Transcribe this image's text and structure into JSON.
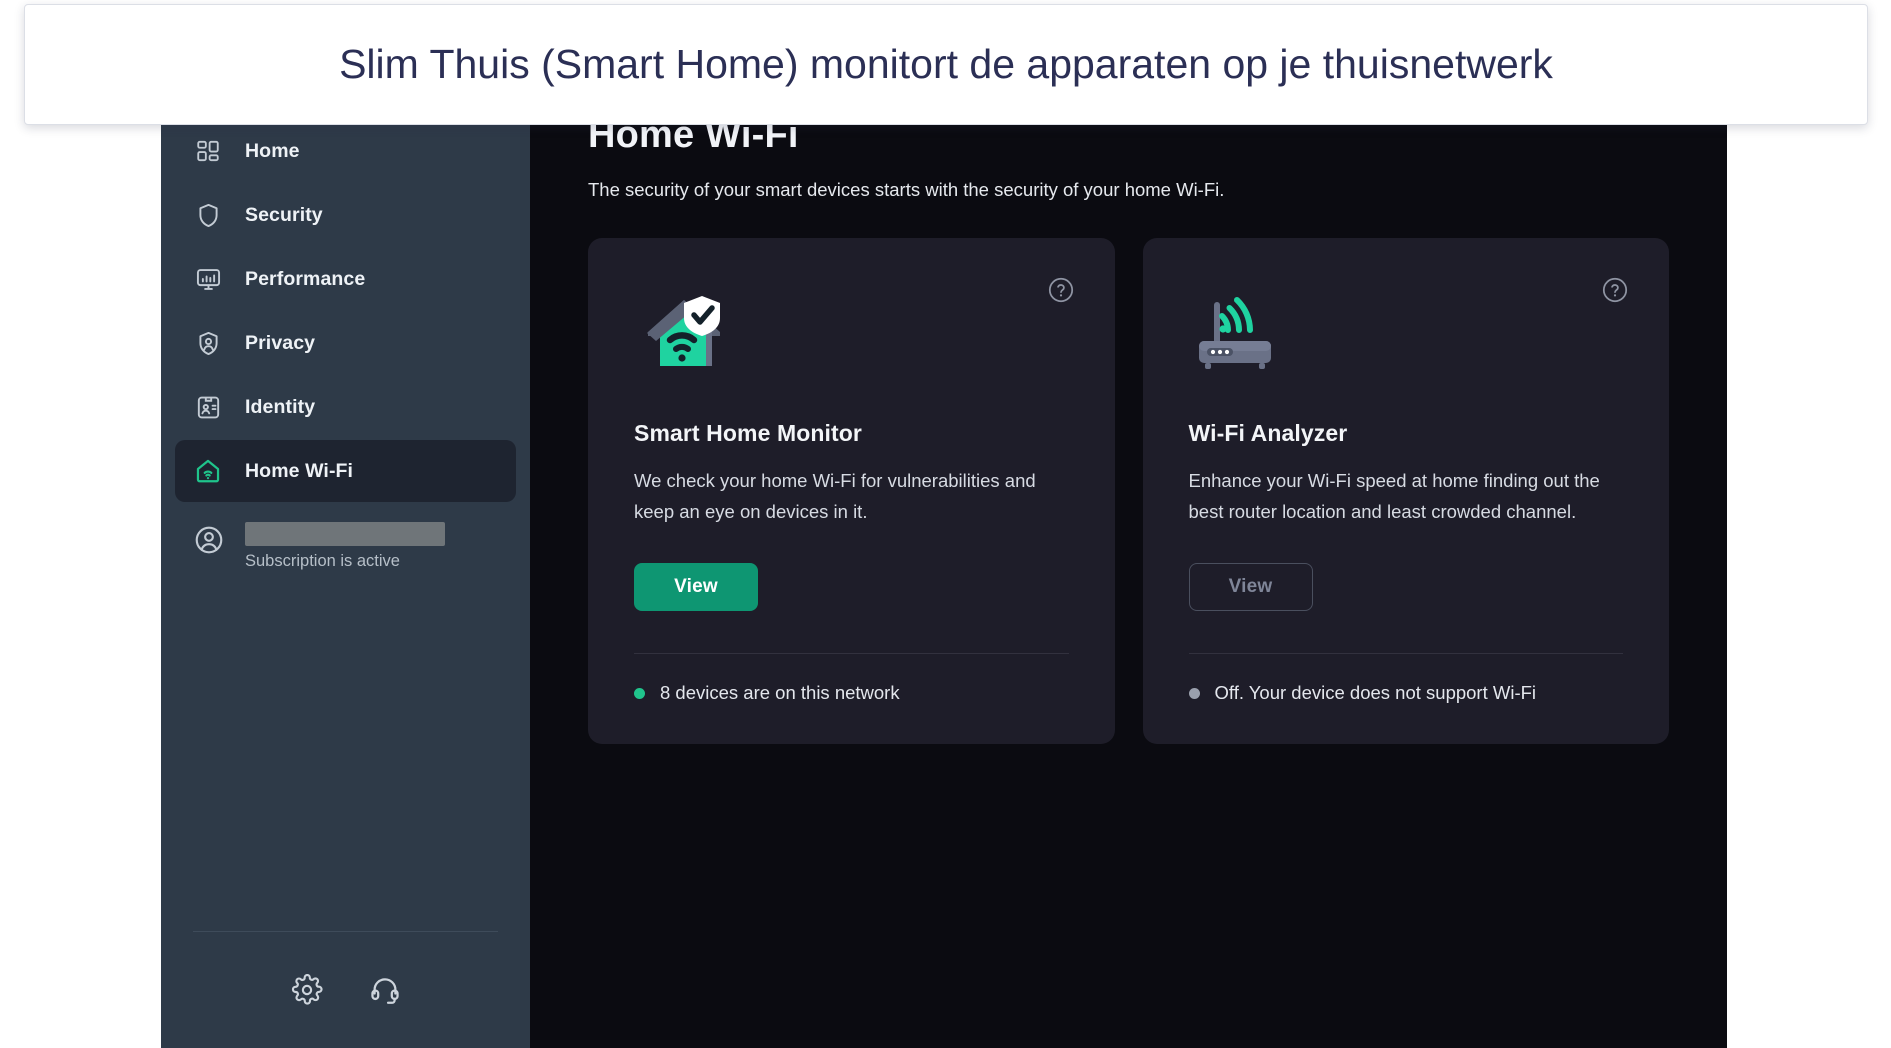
{
  "caption": {
    "text": "Slim Thuis (Smart Home) monitort de apparaten op je thuisnetwerk"
  },
  "sidebar": {
    "items": [
      {
        "label": "Home",
        "icon": "dashboard-grid-icon",
        "active": false
      },
      {
        "label": "Security",
        "icon": "shield-icon",
        "active": false
      },
      {
        "label": "Performance",
        "icon": "monitor-icon",
        "active": false
      },
      {
        "label": "Privacy",
        "icon": "privacy-shield-icon",
        "active": false
      },
      {
        "label": "Identity",
        "icon": "id-card-icon",
        "active": false
      },
      {
        "label": "Home Wi-Fi",
        "icon": "house-wifi-icon",
        "active": true
      }
    ],
    "account": {
      "name_redacted": "",
      "status": "Subscription is active",
      "avatar_icon": "user-circle-icon"
    },
    "footer": {
      "settings_icon": "gear-icon",
      "support_icon": "headset-icon"
    }
  },
  "main": {
    "title": "Home Wi-Fi",
    "subtitle": "The security of your smart devices starts with the security of your home Wi-Fi.",
    "cards": [
      {
        "id": "smart-home-monitor",
        "art_icon": "house-shield-wifi-icon",
        "help_icon": "question-circle-icon",
        "title": "Smart Home Monitor",
        "description": "We check your home Wi-Fi for vulnerabilities and keep an eye on devices in it.",
        "button_label": "View",
        "button_state": "primary",
        "status_text": "8 devices are on this network",
        "status_color": "#20c48c"
      },
      {
        "id": "wifi-analyzer",
        "art_icon": "router-wifi-icon",
        "help_icon": "question-circle-icon",
        "title": "Wi-Fi Analyzer",
        "description": "Enhance your Wi-Fi speed at home finding out the best router location and least crowded channel.",
        "button_label": "View",
        "button_state": "disabled",
        "status_text": "Off. Your device does not support Wi-Fi",
        "status_color": "#9aa0ad"
      }
    ]
  },
  "colors": {
    "accent_green": "#0e9672",
    "icon_green": "#1fc48b",
    "sidebar_bg": "#2e3a48",
    "card_bg": "#1e1d29",
    "main_bg": "#0b0b11"
  }
}
